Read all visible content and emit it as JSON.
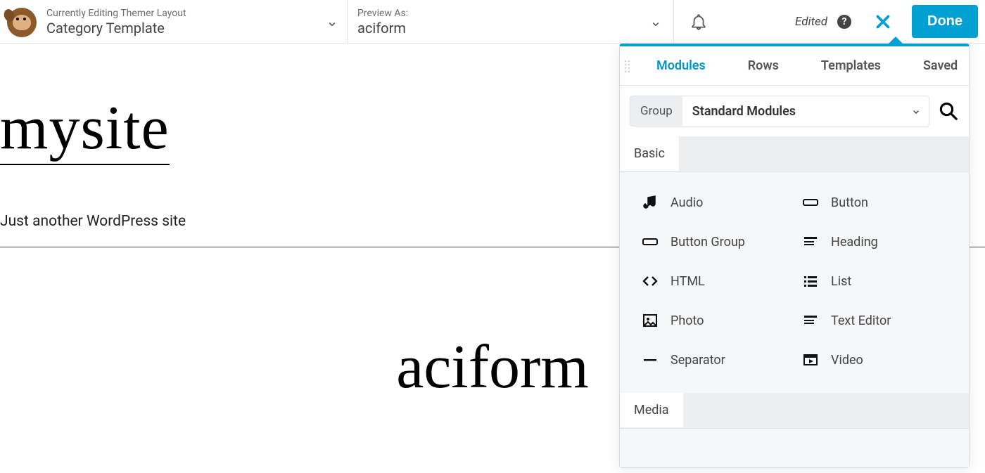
{
  "topbar": {
    "editing_label": "Currently Editing Themer Layout",
    "layout_name": "Category Template",
    "preview_label": "Preview As:",
    "preview_value": "aciform",
    "edited_text": "Edited",
    "done_label": "Done"
  },
  "preview": {
    "site_title": "mysite",
    "tagline": "Just another WordPress site",
    "category_heading": "aciform"
  },
  "panel": {
    "tabs": [
      "Modules",
      "Rows",
      "Templates",
      "Saved"
    ],
    "active_tab": "Modules",
    "group_label": "Group",
    "group_selected": "Standard Modules",
    "sections": [
      {
        "title": "Basic",
        "modules": [
          {
            "icon": "audio-icon",
            "label": "Audio"
          },
          {
            "icon": "button-icon",
            "label": "Button"
          },
          {
            "icon": "button-group-icon",
            "label": "Button Group"
          },
          {
            "icon": "heading-icon",
            "label": "Heading"
          },
          {
            "icon": "html-icon",
            "label": "HTML"
          },
          {
            "icon": "list-icon",
            "label": "List"
          },
          {
            "icon": "photo-icon",
            "label": "Photo"
          },
          {
            "icon": "text-editor-icon",
            "label": "Text Editor"
          },
          {
            "icon": "separator-icon",
            "label": "Separator"
          },
          {
            "icon": "video-icon",
            "label": "Video"
          }
        ]
      },
      {
        "title": "Media",
        "modules": []
      }
    ]
  },
  "colors": {
    "accent": "#00a0d2"
  }
}
